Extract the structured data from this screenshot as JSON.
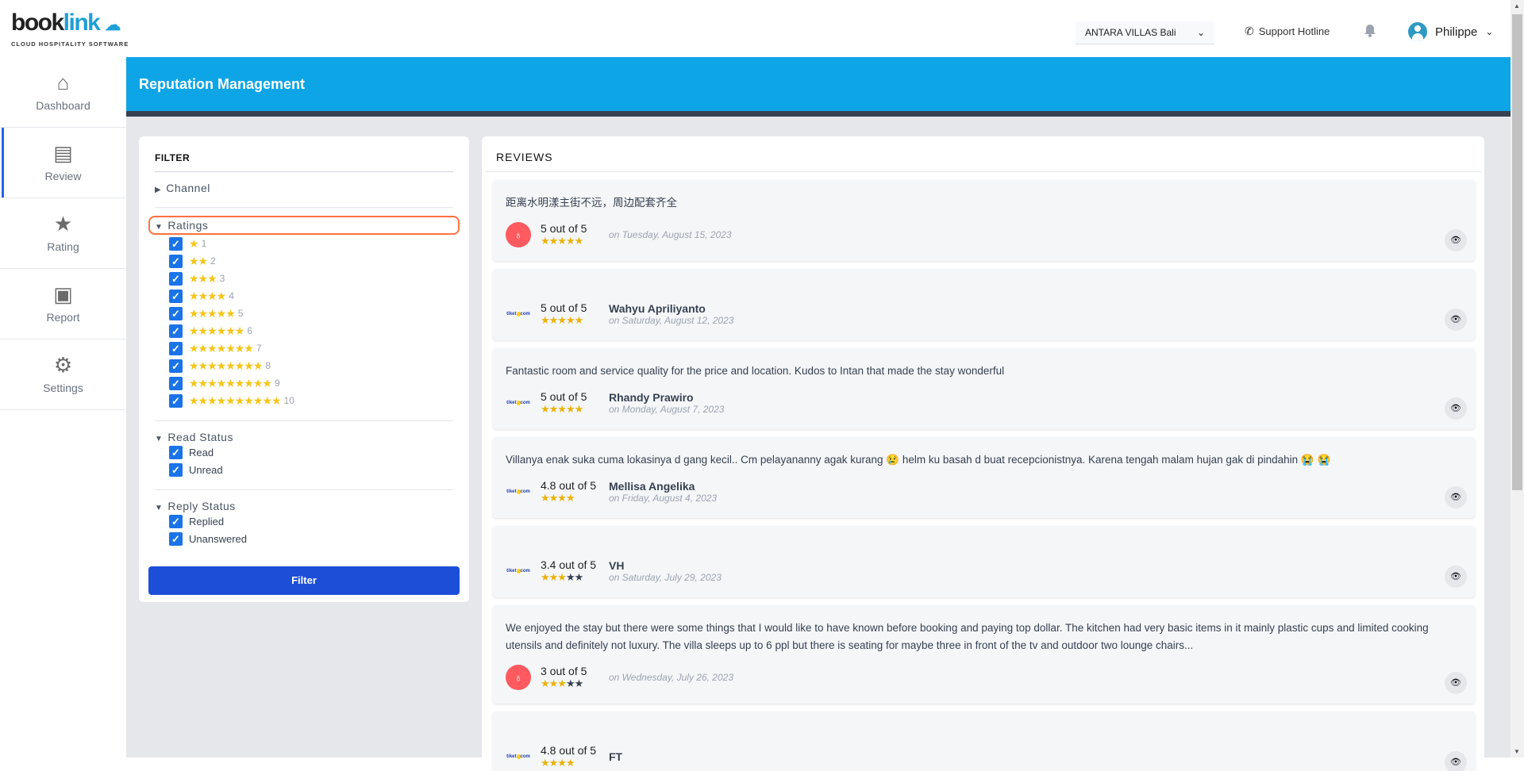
{
  "brand": {
    "logo_word_1": "book",
    "logo_word_2": "link",
    "tagline": "CLOUD HOSPITALITY SOFTWARE"
  },
  "topbar": {
    "hotel": "ANTARA VILLAS Bali",
    "support": "Support Hotline",
    "user": "Philippe"
  },
  "sidebar": {
    "items": [
      {
        "label": "Dashboard",
        "icon": "home-icon"
      },
      {
        "label": "Review",
        "icon": "comment-icon",
        "active": true
      },
      {
        "label": "Rating",
        "icon": "star-icon"
      },
      {
        "label": "Report",
        "icon": "presentation-icon"
      },
      {
        "label": "Settings",
        "icon": "gear-icon"
      }
    ]
  },
  "header": {
    "title": "Reputation Management"
  },
  "filter": {
    "title": "FILTER",
    "channel": "Channel",
    "ratings": "Ratings",
    "rating_options": [
      "1",
      "2",
      "3",
      "4",
      "5",
      "6",
      "7",
      "8",
      "9",
      "10"
    ],
    "read_status": "Read Status",
    "read_options": [
      "Read",
      "Unread"
    ],
    "reply_status": "Reply Status",
    "reply_options": [
      "Replied",
      "Unanswered"
    ],
    "button": "Filter",
    "highlight_color": "#ff7241"
  },
  "reviews": {
    "title": "REVIEWS",
    "items": [
      {
        "text": "距离水明漾主街不远，周边配套齐全",
        "source": "airbnb",
        "score": "5 out of 5",
        "filled": 5,
        "empty": 0,
        "name": "",
        "date": "on Tuesday, August 15, 2023"
      },
      {
        "text": "",
        "source": "tiket.com",
        "score": "5 out of 5",
        "filled": 5,
        "empty": 0,
        "name": "Wahyu Apriliyanto",
        "date": "on Saturday, August 12, 2023"
      },
      {
        "text": "Fantastic room and service quality for the price and location. Kudos to Intan that made the stay wonderful",
        "source": "tiket.com",
        "score": "5 out of 5",
        "filled": 5,
        "empty": 0,
        "name": "Rhandy Prawiro",
        "date": "on Monday, August 7, 2023"
      },
      {
        "text": "Villanya enak suka cuma lokasinya d gang kecil.. Cm pelayananny agak kurang 😢 helm ku basah d buat recepcionistnya. Karena tengah malam hujan gak di pindahin 😭 😭",
        "source": "tiket.com",
        "score": "4.8 out of 5",
        "filled": 4,
        "empty": 0,
        "name": "Mellisa Angelika",
        "date": "on Friday, August 4, 2023"
      },
      {
        "text": "",
        "source": "tiket.com",
        "score": "3.4 out of 5",
        "filled": 3,
        "empty": 2,
        "name": "VH",
        "date": "on Saturday, July 29, 2023"
      },
      {
        "text": "We enjoyed the stay but there were some things that I would like to have known before booking and paying top dollar. The kitchen had very basic items in it mainly plastic cups and limited cooking utensils and definitely not luxury. The villa sleeps up to 6 ppl but there is seating for maybe three in front of the tv and outdoor two lounge chairs...",
        "source": "airbnb",
        "score": "3 out of 5",
        "filled": 3,
        "empty": 2,
        "name": "",
        "date": "on Wednesday, July 26, 2023"
      },
      {
        "text": "",
        "source": "tiket.com",
        "score": "4.8 out of 5",
        "filled": 4,
        "empty": 0,
        "name": "FT",
        "date": ""
      }
    ]
  }
}
